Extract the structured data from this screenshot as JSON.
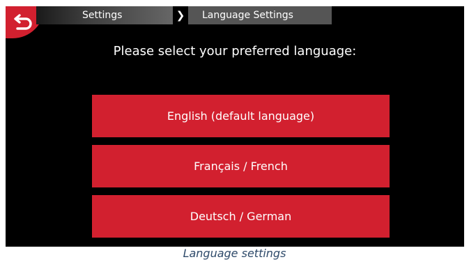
{
  "breadcrumb": {
    "items": [
      {
        "label": "Settings"
      },
      {
        "label": "Language Settings"
      }
    ],
    "separator": "❯"
  },
  "main": {
    "prompt": "Please select your preferred language:",
    "languages": [
      {
        "label": "English (default language)"
      },
      {
        "label": "Français / French"
      },
      {
        "label": "Deutsch / German"
      }
    ]
  },
  "caption": "Language settings",
  "icons": {
    "back": "back-arrow-icon",
    "separator": "chevron-right-icon"
  },
  "colors": {
    "accent": "#d2202f",
    "background": "#000000",
    "text": "#ffffff",
    "caption": "#2e4a6a"
  }
}
